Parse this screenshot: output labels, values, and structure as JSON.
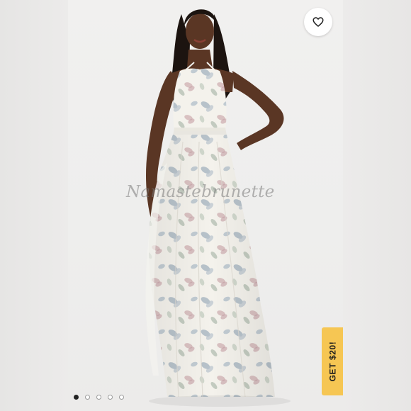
{
  "watermark": {
    "text": "Namastebrunette"
  },
  "favorite": {
    "icon": "heart-outline-icon",
    "color": "#222222"
  },
  "promo": {
    "label": "GET $20!",
    "color": "#f6c653"
  },
  "carousel": {
    "count": 5,
    "active_index": 0
  },
  "product_photo": {
    "description_icon": "floral-maxi-dress-photo",
    "dress_base": "#f4f2ec",
    "print_colors": [
      "#9aa9b8",
      "#c9a9ad",
      "#a7b5a7",
      "#b6bfcb"
    ],
    "skin": "#5a3624",
    "hair": "#1c1410"
  }
}
